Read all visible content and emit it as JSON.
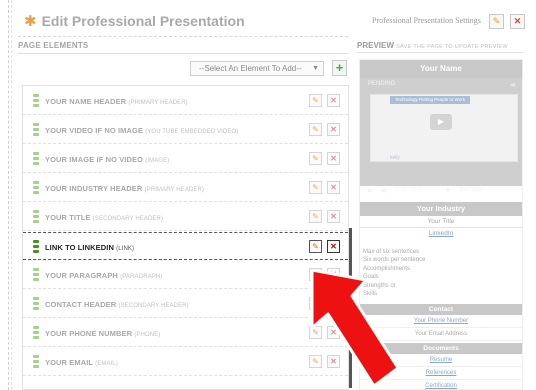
{
  "header": {
    "title": "Edit Professional Presentation",
    "settings_link": "Professional Presentation Settings",
    "edit_icon": "pencil-icon",
    "delete_icon": "close-icon"
  },
  "page_elements": {
    "section_label": "PAGE ELEMENTS",
    "select_placeholder": "--Select An Element To Add--",
    "add_icon": "plus-icon",
    "rows": [
      {
        "label": "YOUR NAME HEADER",
        "type": "(PRIMARY HEADER)"
      },
      {
        "label": "YOUR VIDEO IF NO IMAGE",
        "type": "(YOU TUBE EMBEDDED VIDEO)"
      },
      {
        "label": "YOUR IMAGE IF NO VIDEO",
        "type": "(IMAGE)"
      },
      {
        "label": "YOUR INDUSTRY HEADER",
        "type": "(PRIMARY HEADER)"
      },
      {
        "label": "YOUR TITLE",
        "type": "(SECONDARY HEADER)"
      },
      {
        "label": "LINK TO LINKEDIN",
        "type": "(LINK)"
      },
      {
        "label": "YOUR PARAGRAPH",
        "type": "(PARAGRAPH)"
      },
      {
        "label": "CONTACT HEADER",
        "type": "(SECONDARY HEADER)"
      },
      {
        "label": "YOUR PHONE NUMBER",
        "type": "(PHONE)"
      },
      {
        "label": "YOUR EMAIL",
        "type": "(EMAIL)"
      }
    ],
    "active_index": 5
  },
  "preview": {
    "label": "PREVIEW",
    "hint": "SAVE THE PAGE TO UPDATE PREVIEW",
    "name": "Your Name",
    "video_status": "PENDING",
    "video_banner": "Technology Putting People to Work",
    "video_logo": "kelly",
    "video_time": "0:00 / 0:57",
    "video_brand": "YouTube",
    "industry": "Your Industry",
    "title": "Your Title",
    "linkedin": "LinkedIn",
    "paragraph": [
      "Max of six sentences",
      "Six words per sentence",
      "Accomplishments",
      "Goals",
      "Strengths or",
      "Skills"
    ],
    "contact_header": "Contact",
    "phone": "Your Phone Number",
    "email": "Your Email Address",
    "documents_header": "Documents",
    "documents": [
      "Resume",
      "References",
      "Certification"
    ]
  },
  "colors": {
    "accent_green": "#5aa43b",
    "annotation_arrow": "#ee1111"
  }
}
